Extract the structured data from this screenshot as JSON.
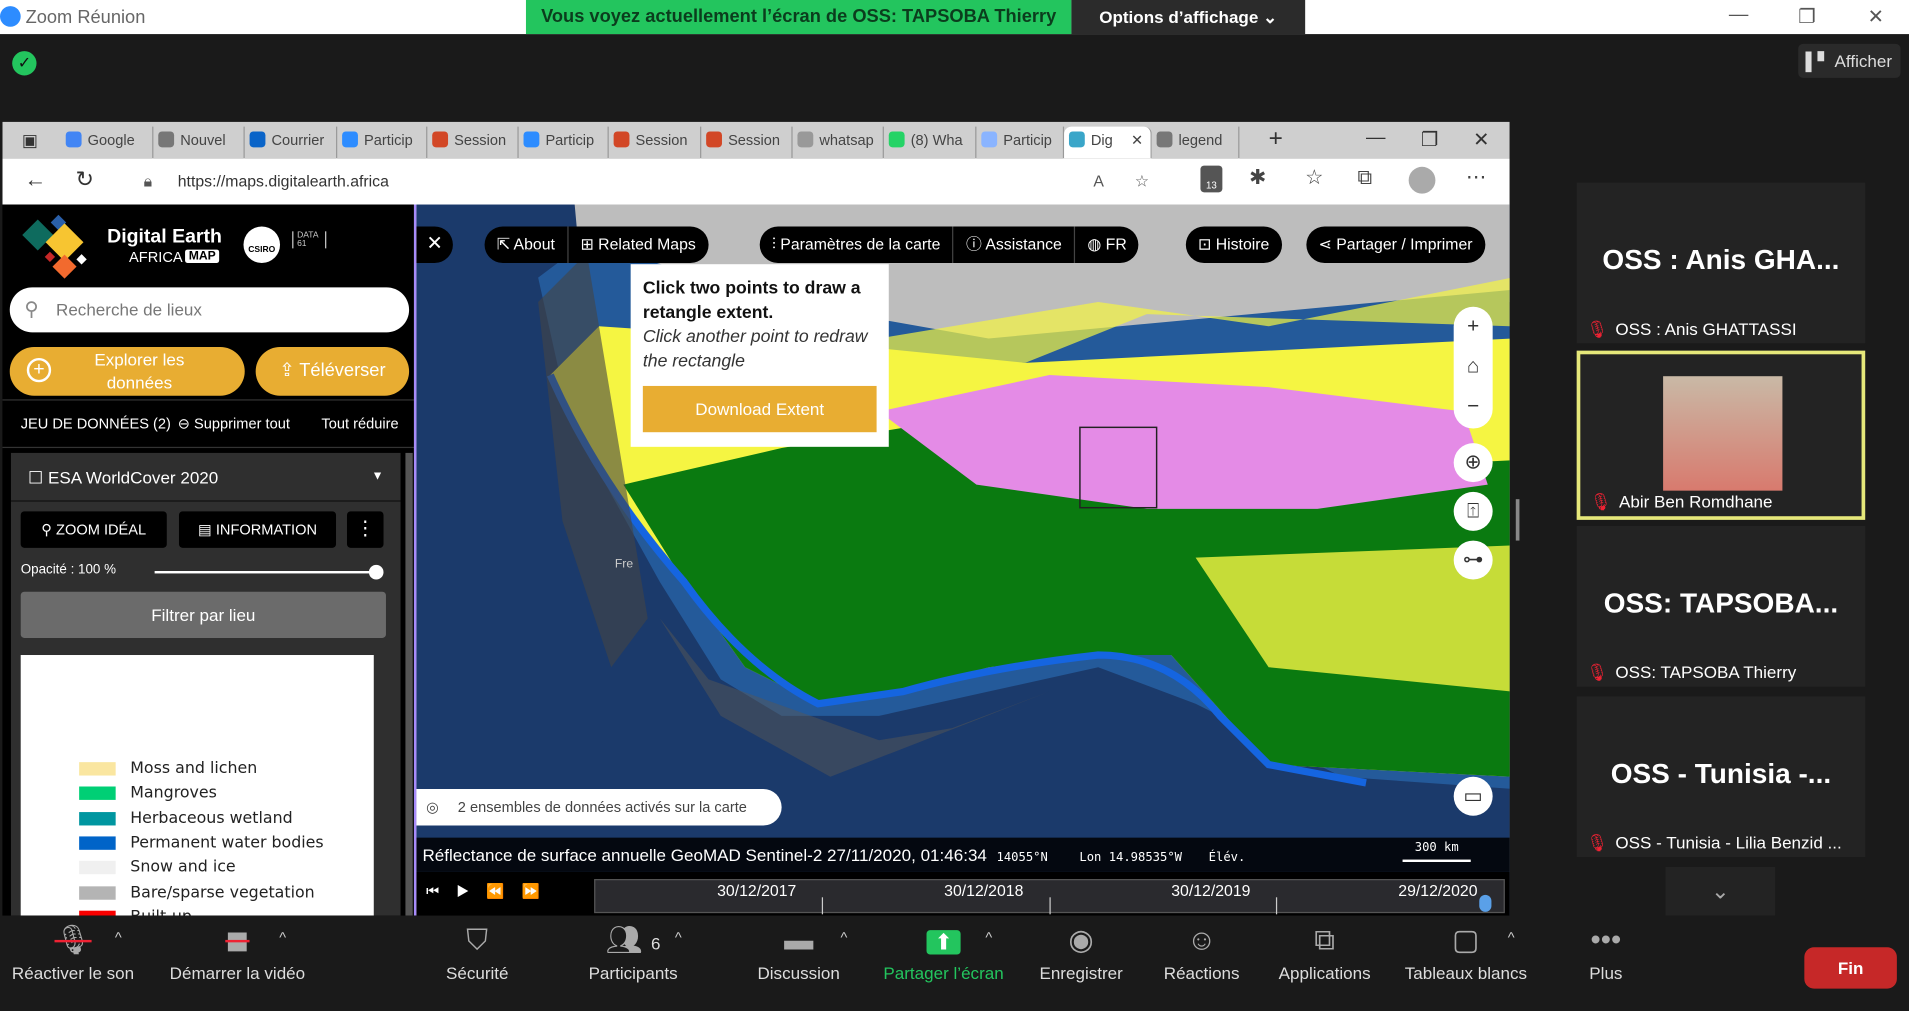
{
  "zoom": {
    "app_title": "Zoom Réunion",
    "banner": "Vous voyez actuellement l’écran de OSS: TAPSOBA Thierry",
    "options": "Options d’affichage ⌄",
    "afficher": "Afficher"
  },
  "browser": {
    "tabs": [
      {
        "label": "Google",
        "color": "#4285f4"
      },
      {
        "label": "Nouvel",
        "color": "#777"
      },
      {
        "label": "Courrier",
        "color": "#0a64c8"
      },
      {
        "label": "Particip",
        "color": "#2d8cff"
      },
      {
        "label": "Session",
        "color": "#d24726"
      },
      {
        "label": "Particip",
        "color": "#2d8cff"
      },
      {
        "label": "Session",
        "color": "#d24726"
      },
      {
        "label": "Session",
        "color": "#d24726"
      },
      {
        "label": "whatsap",
        "color": "#999"
      },
      {
        "label": "(8) Wha",
        "color": "#25d366"
      },
      {
        "label": "Particip",
        "color": "#8ab4ff"
      },
      {
        "label": "Dig",
        "color": "#3aa6c9"
      },
      {
        "label": "legend",
        "color": "#777"
      }
    ],
    "url": "https://maps.digitalearth.africa",
    "extensions_badge": "13"
  },
  "sidebar": {
    "logo_title": "Digital Earth",
    "logo_sub": "AFRICA",
    "logo_badge": "MAP",
    "csiro": "CSIRO",
    "data61": "DATA 61",
    "search_placeholder": "Recherche de lieux",
    "explore": "Explorer les données",
    "upload": "Téléverser",
    "datasets_label": "JEU DE DONNÉES (2)",
    "remove_all": "Supprimer tout",
    "collapse_all": "Tout réduire",
    "dataset": {
      "name": "ESA WorldCover 2020",
      "zoom": "ZOOM IDÉAL",
      "info": "INFORMATION",
      "opacity_label": "Opacité : 100 %",
      "opacity": 100,
      "filter": "Filtrer par lieu"
    },
    "legend": [
      {
        "label": "Moss and lichen",
        "color": "#fae6a0"
      },
      {
        "label": "Mangroves",
        "color": "#00cf75"
      },
      {
        "label": "Herbaceous wetland",
        "color": "#0096a0"
      },
      {
        "label": "Permanent water bodies",
        "color": "#0064c8"
      },
      {
        "label": "Snow and ice",
        "color": "#f0f0f0"
      },
      {
        "label": "Bare/sparse vegetation",
        "color": "#b4b4b4"
      },
      {
        "label": "Built-up",
        "color": "#fa0000"
      }
    ]
  },
  "map": {
    "toolbar": {
      "about": "About",
      "related": "Related Maps",
      "settings": "Paramètres de la carte",
      "help": "Assistance",
      "lang": "FR",
      "story": "Histoire",
      "share": "Partager / Imprimer"
    },
    "popup": {
      "title": "Click two points to draw a retangle extent.",
      "hint": "Click another point to redraw the rectangle",
      "button": "Download Extent"
    },
    "place_label": "Fre",
    "active_notice": "2 ensembles de données activés sur la carte",
    "status": {
      "layer": "Réflectance de surface annuelle GeoMAD Sentinel-2 27/11/2020, 01:46:34",
      "lat": "14055°N",
      "lon": "Lon 14.98535°W",
      "elev": "Élév.",
      "scale": "300 km"
    },
    "timeline": [
      "30/12/2017",
      "30/12/2018",
      "30/12/2019",
      "29/12/2020"
    ]
  },
  "participants": [
    {
      "tile": "OSS : Anis GHA...",
      "name": "OSS : Anis GHATTASSI"
    },
    {
      "tile": "",
      "name": "Abir Ben Romdhane"
    },
    {
      "tile": "OSS:  TAPSOBA...",
      "name": "OSS: TAPSOBA Thierry"
    },
    {
      "tile": "OSS  - Tunisia -...",
      "name": "OSS - Tunisia - Lilia Benzid ..."
    }
  ],
  "toolbar": {
    "unmute": "Réactiver le son",
    "video": "Démarrer la vidéo",
    "security": "Sécurité",
    "participants": "Participants",
    "participants_count": "6",
    "chat": "Discussion",
    "share": "Partager l’écran",
    "record": "Enregistrer",
    "reactions": "Réactions",
    "apps": "Applications",
    "whiteboards": "Tableaux blancs",
    "more": "Plus",
    "end": "Fin"
  }
}
